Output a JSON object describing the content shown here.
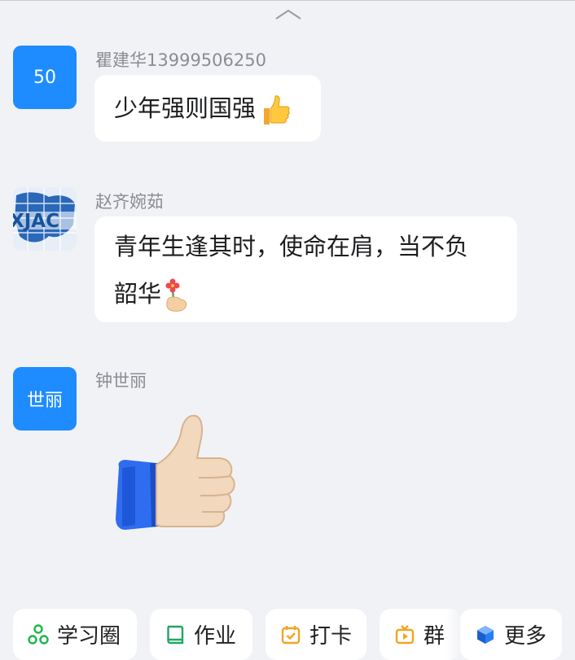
{
  "messages": [
    {
      "avatar_text": "50",
      "sender": "瞿建华13999506250",
      "text": "少年强则国强",
      "emoji": "thumbs-up"
    },
    {
      "avatar_image": "xjac-logo",
      "avatar_text": "XJAC",
      "sender": "赵齐婉茹",
      "text_line1": "青年生逢其时，使命在肩，当不负",
      "text_line2": "韶华",
      "emoji": "hand-with-flower"
    },
    {
      "avatar_text": "世丽",
      "sender": "钟世丽",
      "sticker": "thumbs-up"
    }
  ],
  "toolbar": {
    "study_circle": "学习圈",
    "homework": "作业",
    "checkin": "打卡",
    "group_partial": "群",
    "more": "更多"
  },
  "colors": {
    "background": "#f1f2f5",
    "avatar_blue": "#1e8cff",
    "sender_gray": "#8a8d93",
    "study_icon_green": "#19b84a",
    "homework_icon_green": "#1fa862",
    "checkin_icon_orange": "#f2a322",
    "more_icon_blue": "#2a7ef5"
  }
}
